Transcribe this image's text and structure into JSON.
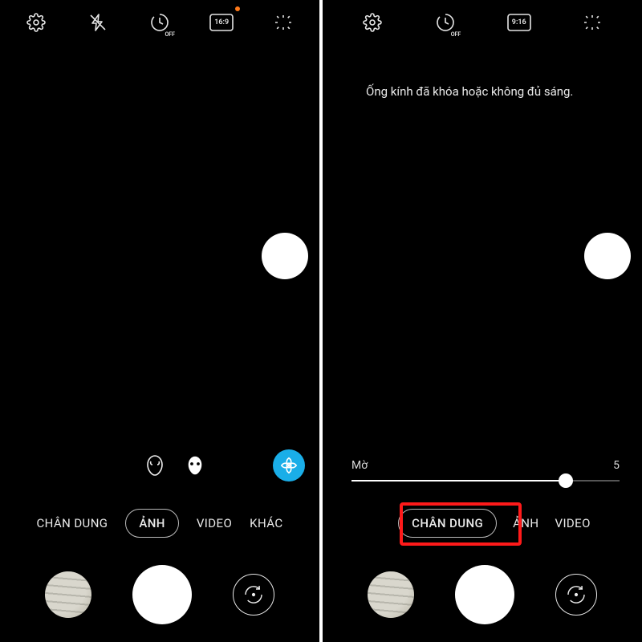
{
  "left": {
    "top_icons": [
      "settings",
      "flash-off",
      "timer-off",
      "aspect-16-9",
      "magic"
    ],
    "aspect_label": "16:9",
    "aspect_indicator": true,
    "modes": [
      "CHÂN DUNG",
      "ẢNH",
      "VIDEO",
      "KHÁC"
    ],
    "active_mode_index": 1
  },
  "right": {
    "top_icons": [
      "settings",
      "timer-off",
      "aspect-9-16",
      "magic"
    ],
    "aspect_label": "9:16",
    "warning": "Ống kính đã khóa hoặc không đủ sáng.",
    "slider": {
      "label_left": "Mờ",
      "label_right": "5",
      "position_pct": 80
    },
    "modes": [
      "CHÂN DUNG",
      "ẢNH",
      "VIDEO"
    ],
    "active_mode_index": 0,
    "highlight_mode_index": 0
  },
  "colors": {
    "accent": "#1aaee8",
    "highlight": "#ff1a1a",
    "indicator": "#ff7a1a"
  }
}
